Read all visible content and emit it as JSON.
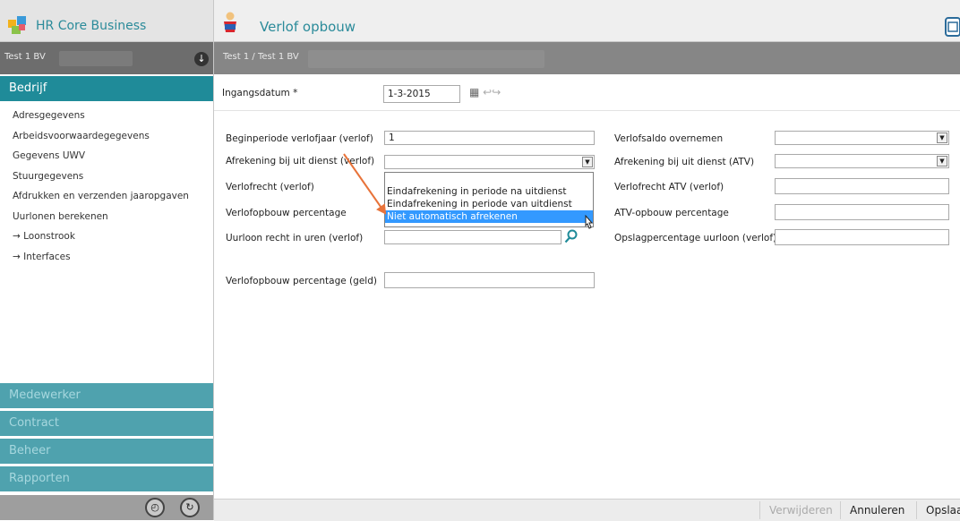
{
  "header": {
    "app_title": "HR Core Business",
    "page_title": "Verlof opbouw"
  },
  "company_bar": {
    "left_company": "Test 1 BV",
    "breadcrumb": "Test 1 / Test 1 BV"
  },
  "sidebar": {
    "active_section": "Bedrijf",
    "links": [
      {
        "label": "Adresgegevens"
      },
      {
        "label": "Arbeidsvoorwaardegegevens"
      },
      {
        "label": "Gegevens UWV"
      },
      {
        "label": "Stuurgegevens"
      },
      {
        "label": "Afdrukken en verzenden jaaropgaven"
      },
      {
        "label": "Uurlonen berekenen"
      },
      {
        "label": "→ Loonstrook"
      },
      {
        "label": "→ Interfaces"
      }
    ],
    "sections": [
      {
        "label": "Medewerker"
      },
      {
        "label": "Contract"
      },
      {
        "label": "Beheer"
      },
      {
        "label": "Rapporten"
      }
    ]
  },
  "form": {
    "ingangsdatum": {
      "label": "Ingangsdatum *",
      "value": "1-3-2015"
    },
    "left": {
      "beginperiode": {
        "label": "Beginperiode verlofjaar (verlof)",
        "value": "1"
      },
      "afrekening": {
        "label": "Afrekening bij uit dienst (verlof)",
        "value": ""
      },
      "verlofrecht": {
        "label": "Verlofrecht (verlof)",
        "value": ""
      },
      "opbouw_pct": {
        "label": "Verlofopbouw percentage",
        "value": ""
      },
      "uurloon_recht": {
        "label": "Uurloon recht in uren (verlof)",
        "value": ""
      },
      "opbouw_pct_geld": {
        "label": "Verlofopbouw percentage (geld)",
        "value": ""
      }
    },
    "right": {
      "saldo_overnemen": {
        "label": "Verlofsaldo overnemen",
        "value": ""
      },
      "afrekening_atv": {
        "label": "Afrekening bij uit dienst (ATV)",
        "value": ""
      },
      "verlofrecht_atv": {
        "label": "Verlofrecht ATV (verlof)",
        "value": ""
      },
      "atv_opbouw_pct": {
        "label": "ATV-opbouw percentage",
        "value": ""
      },
      "opslag_pct": {
        "label": "Opslagpercentage uurloon (verlof)",
        "value": ""
      }
    },
    "dropdown_options": [
      {
        "label": "Eindafrekening in periode na uitdienst",
        "selected": false
      },
      {
        "label": "Eindafrekening in periode van uitdienst",
        "selected": false
      },
      {
        "label": "Niet automatisch afrekenen",
        "selected": true
      }
    ]
  },
  "footer": {
    "delete_label": "Verwijderen",
    "cancel_label": "Annuleren",
    "save_label": "Opslaa"
  },
  "colors": {
    "accent": "#2b8b9a",
    "sidebar_active": "#1f8b99",
    "sidebar_section": "#4fa2ae",
    "selected_option": "#3399ff",
    "annotation_arrow": "#e8733a"
  },
  "icons": {
    "app": "app-logo-icon",
    "page": "person-reading-icon",
    "calendar": "calendar-icon",
    "search": "search-icon",
    "down": "arrow-down-circle-icon"
  }
}
